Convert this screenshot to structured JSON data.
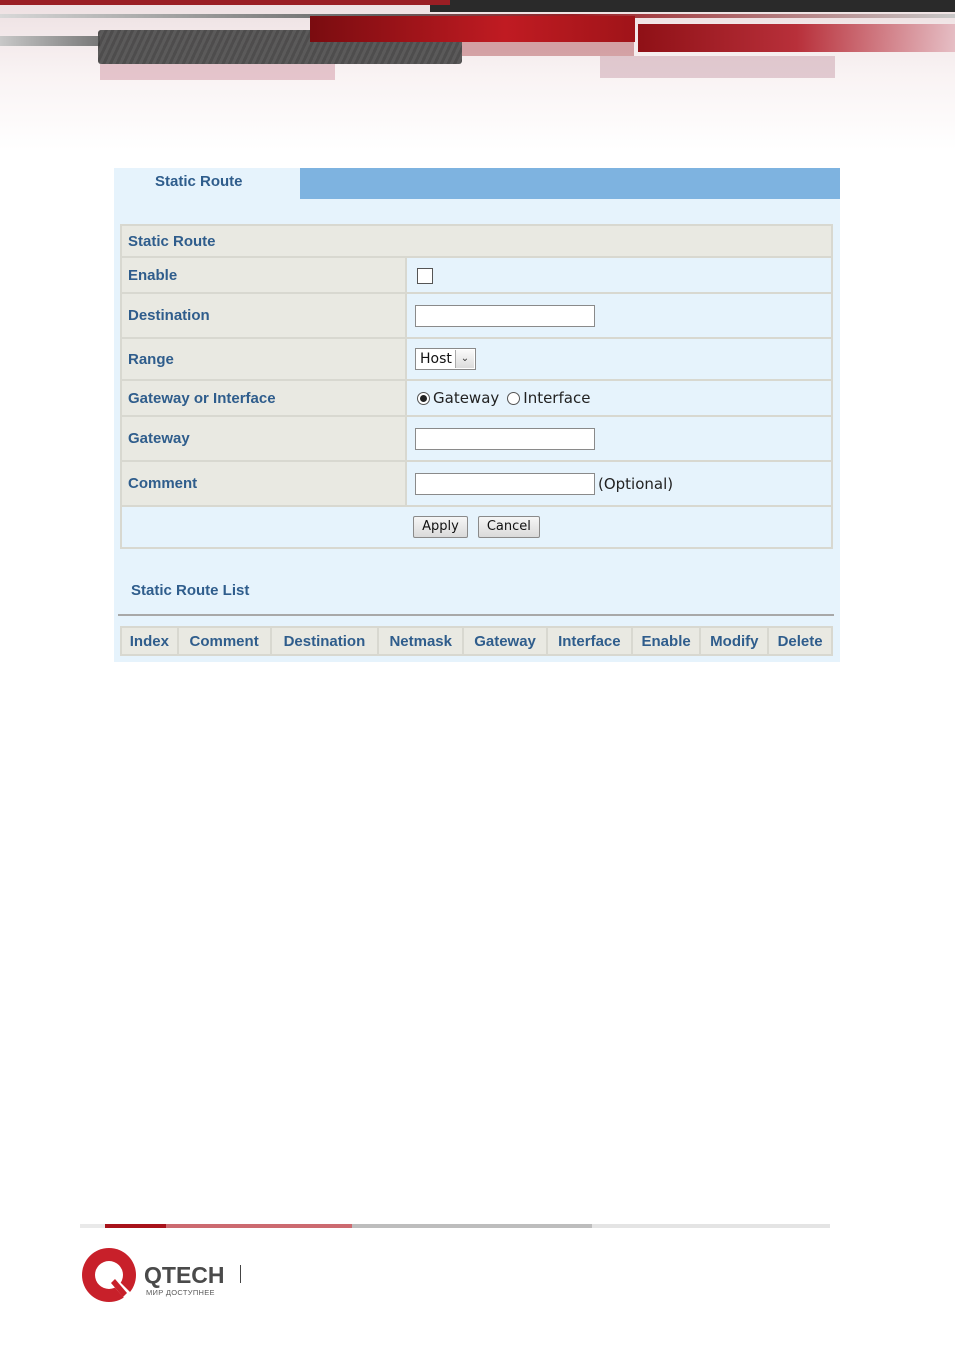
{
  "tab": {
    "label": "Static Route"
  },
  "form": {
    "section_title": "Static Route",
    "enable_label": "Enable",
    "destination_label": "Destination",
    "range_label": "Range",
    "range_value": "Host",
    "gateway_or_interface_label": "Gateway or Interface",
    "radio_gateway": "Gateway",
    "radio_interface": "Interface",
    "selected_option": "Gateway",
    "gateway_label": "Gateway",
    "comment_label": "Comment",
    "comment_hint": "(Optional)",
    "apply_label": "Apply",
    "cancel_label": "Cancel"
  },
  "list": {
    "title": "Static Route List",
    "columns": [
      "Index",
      "Comment",
      "Destination",
      "Netmask",
      "Gateway",
      "Interface",
      "Enable",
      "Modify",
      "Delete"
    ]
  },
  "footer": {
    "brand": "QTECH",
    "tagline": "МИР ДОСТУПНЕЕ"
  },
  "colors": {
    "panel_bg": "#e6f3fc",
    "tab_bar": "#7eb3e0",
    "label_text": "#2f5d8c",
    "label_bg": "#e9e9e2",
    "brand_red": "#c8202a"
  }
}
